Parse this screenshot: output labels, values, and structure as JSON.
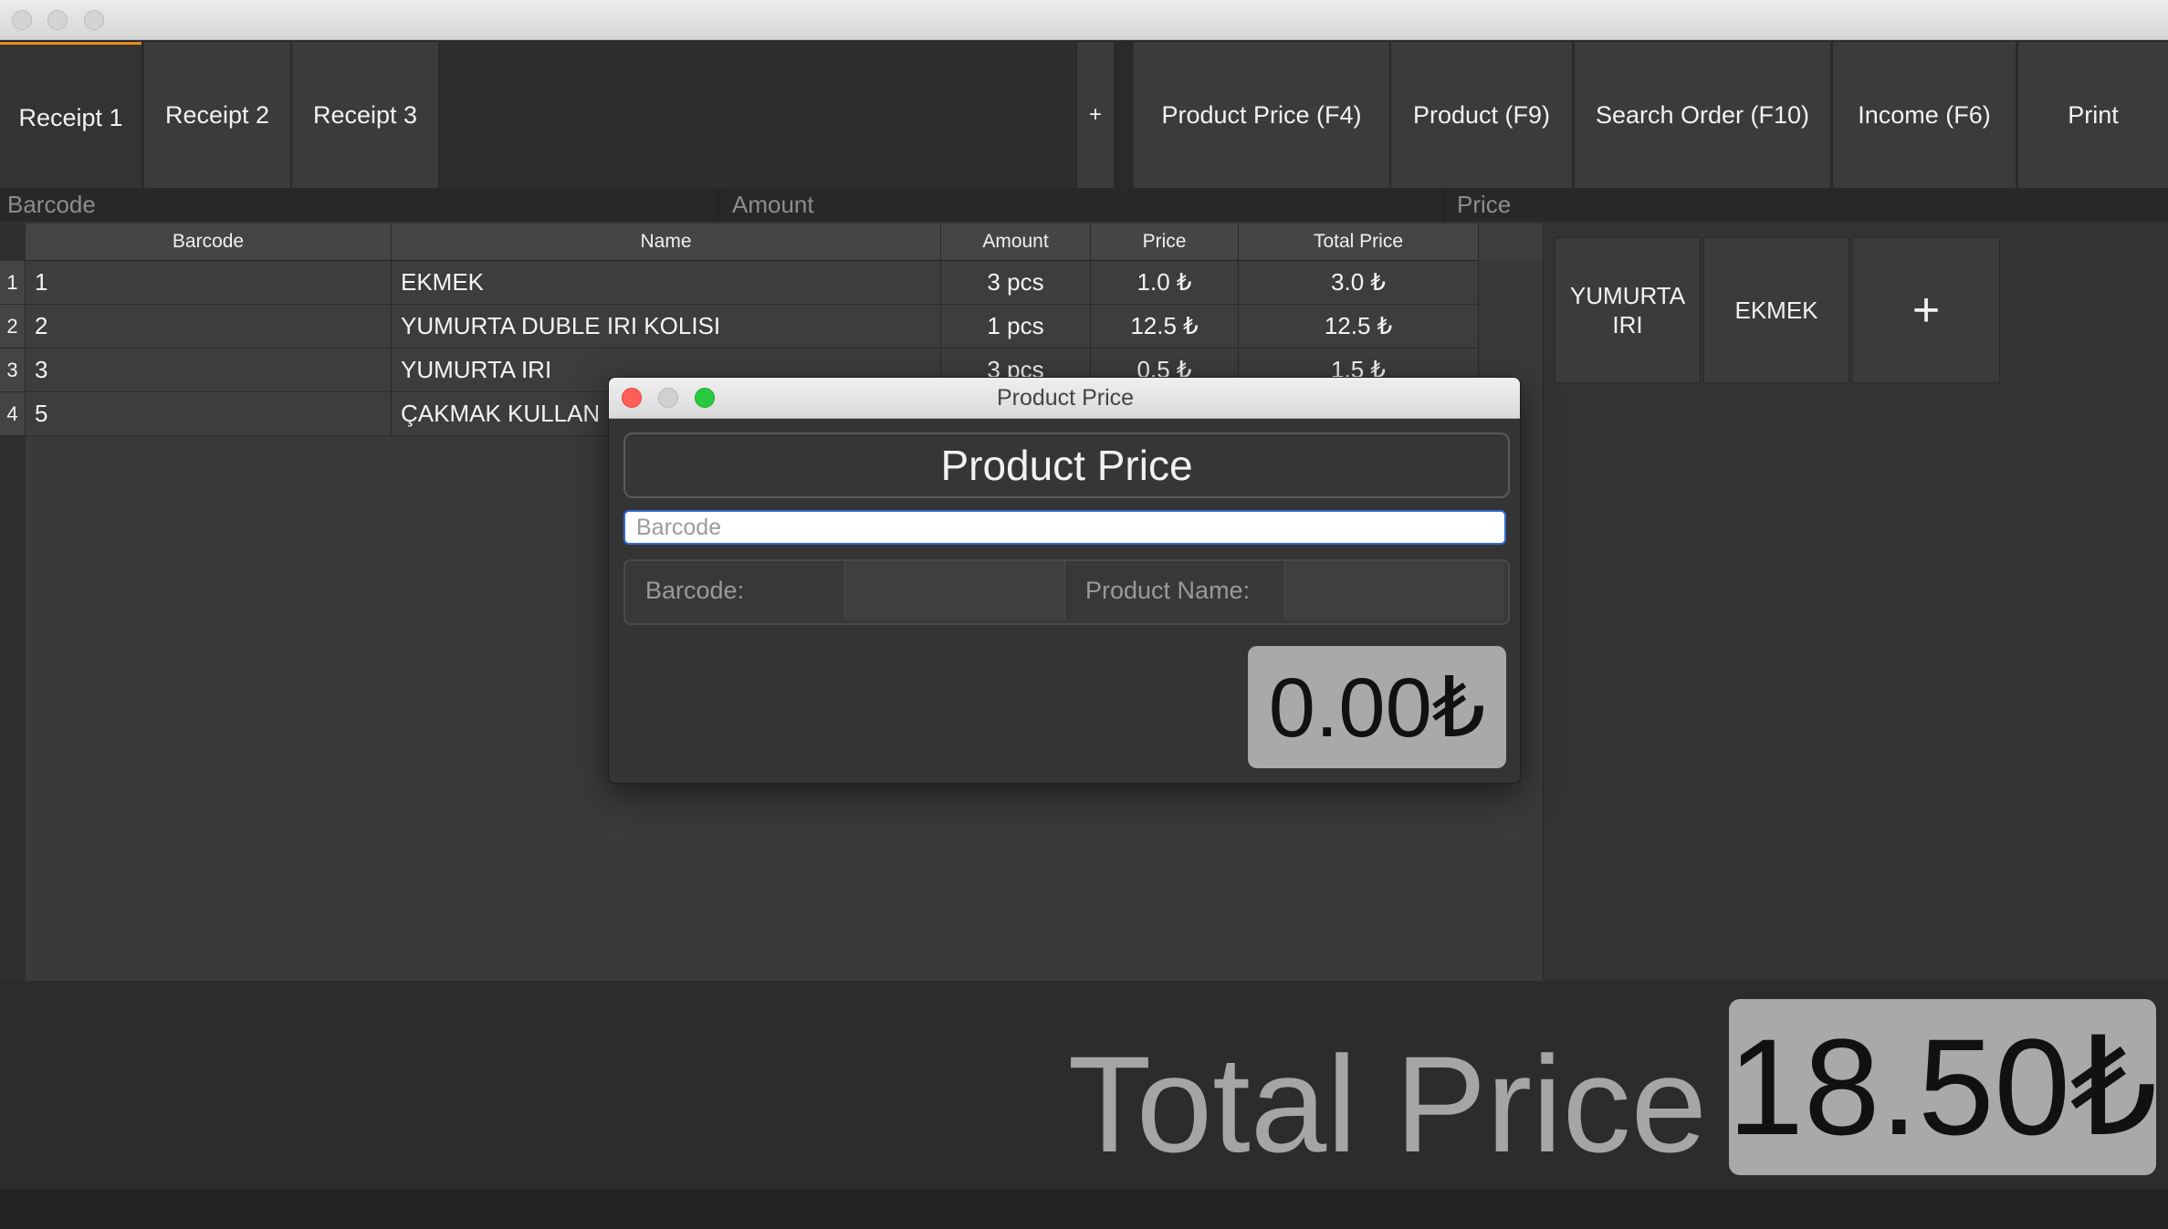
{
  "tabs": [
    {
      "label": "Receipt 1",
      "active": true
    },
    {
      "label": "Receipt 2",
      "active": false
    },
    {
      "label": "Receipt 3",
      "active": false
    }
  ],
  "add_tab_label": "+",
  "actions": [
    {
      "label": "Product Price (F4)"
    },
    {
      "label": "Product (F9)"
    },
    {
      "label": "Search Order (F10)"
    },
    {
      "label": "Income (F6)"
    },
    {
      "label": "Print"
    }
  ],
  "inputs": {
    "barcode_placeholder": "Barcode",
    "amount_placeholder": "Amount",
    "price_placeholder": "Price"
  },
  "table": {
    "columns": [
      "Barcode",
      "Name",
      "Amount",
      "Price",
      "Total Price"
    ],
    "rows": [
      {
        "num": "1",
        "barcode": "1",
        "name": "EKMEK",
        "amount": "3 pcs",
        "price": "1.0 ₺",
        "total": "3.0 ₺"
      },
      {
        "num": "2",
        "barcode": "2",
        "name": "YUMURTA DUBLE IRI KOLISI",
        "amount": "1 pcs",
        "price": "12.5 ₺",
        "total": "12.5 ₺"
      },
      {
        "num": "3",
        "barcode": "3",
        "name": "YUMURTA IRI",
        "amount": "3 pcs",
        "price": "0.5 ₺",
        "total": "1.5 ₺"
      },
      {
        "num": "4",
        "barcode": "5",
        "name": "ÇAKMAK KULLAN",
        "amount": "",
        "price": "",
        "total": ""
      }
    ]
  },
  "quick_products": [
    {
      "label": "YUMURTA IRI"
    },
    {
      "label": "EKMEK"
    },
    {
      "label": "+"
    }
  ],
  "total": {
    "label": "Total Price",
    "value": "18.50₺"
  },
  "dialog": {
    "window_title": "Product Price",
    "header": "Product Price",
    "search_placeholder": "Barcode",
    "barcode_label": "Barcode:",
    "barcode_value": "",
    "product_name_label": "Product Name:",
    "product_name_value": "",
    "price": "0.00₺"
  },
  "colors": {
    "accent": "#e98c1d",
    "close": "#fe5f57",
    "minimize": "#d0d0d0",
    "zoom": "#28c840",
    "focus": "#2f6bd1"
  }
}
